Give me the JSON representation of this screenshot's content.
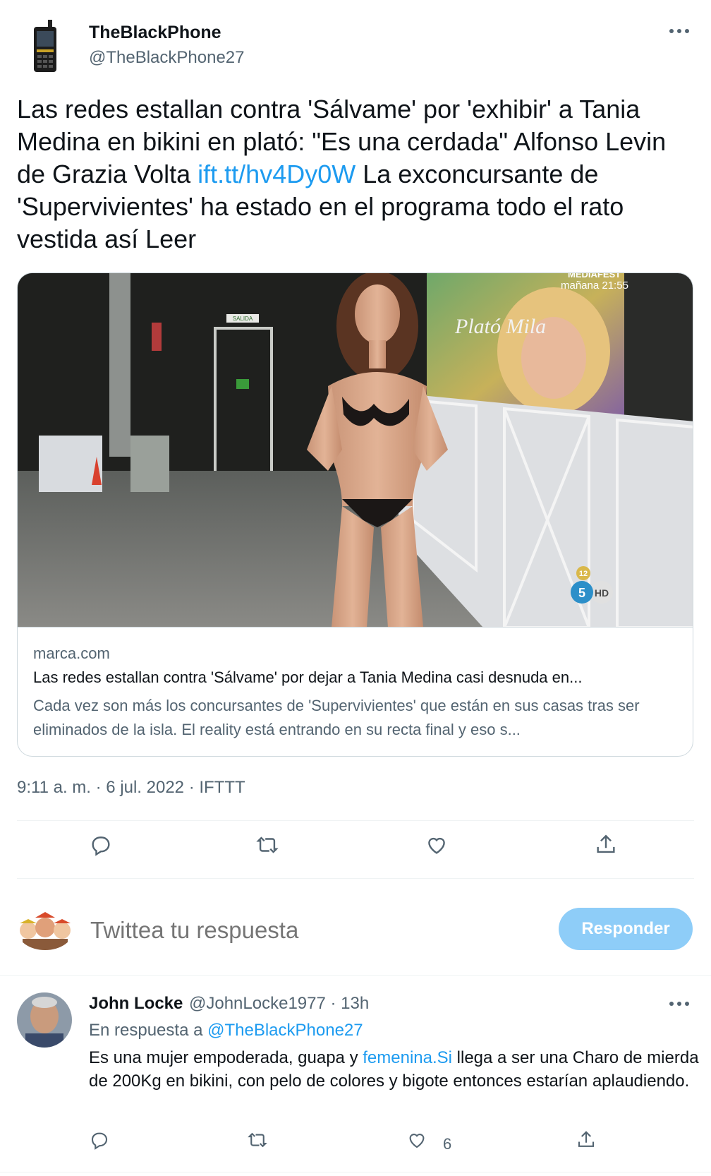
{
  "author": {
    "name": "TheBlackPhone",
    "handle": "@TheBlackPhone27"
  },
  "tweet": {
    "text_before_link": "Las redes estallan contra 'Sálvame' por 'exhibir' a Tania Medina en bikini en plató: \"Es una cerdada\" Alfonso Levin de Grazia Volta ",
    "link": "ift.tt/hv4Dy0W",
    "text_after_link": " La exconcursante de 'Supervivientes' ha estado en el programa todo el rato vestida así  Leer",
    "timestamp": "9:11 a. m. · 6 jul. 2022 · IFTTT"
  },
  "card": {
    "image_overlay": {
      "channel_text": "MEDIAFEST",
      "schedule": "mañana 21:55",
      "sign_text": "Plató Mila",
      "exit_sign": "SALIDA",
      "rating": "12",
      "hd_badge": "HD",
      "channel_number": "5"
    },
    "domain": "marca.com",
    "title": "Las redes estallan contra 'Sálvame' por dejar a Tania Medina casi desnuda en...",
    "description": "Cada vez son más los concursantes de 'Supervivientes' que están en sus casas tras ser eliminados de la isla. El reality está entrando en su recta final y eso s..."
  },
  "actions": [
    "reply-icon",
    "retweet-icon",
    "like-icon",
    "share-icon"
  ],
  "composer": {
    "placeholder": "Twittea tu respuesta",
    "button_label": "Responder"
  },
  "reply": {
    "name": "John Locke",
    "meta": "@JohnLocke1977 · 13h",
    "context_prefix": "En respuesta a ",
    "context_mention": "@TheBlackPhone27",
    "text_before_link": "Es una mujer empoderada, guapa y ",
    "link": "femenina.Si",
    "text_after_link": " llega a ser una Charo de mierda de 200Kg en bikini, con pelo de colores y bigote entonces estarían aplaudiendo.",
    "like_count": "6"
  },
  "colors": {
    "link": "#1d9bf0",
    "muted": "#536471",
    "button": "#8ecdf8"
  }
}
